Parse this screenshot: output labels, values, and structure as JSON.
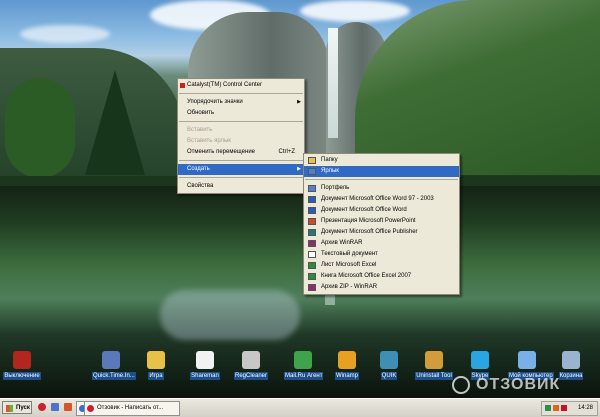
{
  "context_menu": {
    "items": [
      {
        "label": "Catalyst(TM) Control Center",
        "shortcut": "",
        "arrow": false,
        "disabled": false,
        "selected": false
      },
      {
        "separator": true
      },
      {
        "label": "Упорядочить значки",
        "shortcut": "",
        "arrow": true,
        "disabled": false,
        "selected": false
      },
      {
        "label": "Обновить",
        "shortcut": "",
        "arrow": false,
        "disabled": false,
        "selected": false
      },
      {
        "separator": true
      },
      {
        "label": "Вставить",
        "shortcut": "",
        "arrow": false,
        "disabled": true,
        "selected": false
      },
      {
        "label": "Вставить ярлык",
        "shortcut": "",
        "arrow": false,
        "disabled": true,
        "selected": false
      },
      {
        "label": "Отменить перемещение",
        "shortcut": "Ctrl+Z",
        "arrow": false,
        "disabled": false,
        "selected": false
      },
      {
        "separator": true
      },
      {
        "label": "Создать",
        "shortcut": "",
        "arrow": true,
        "disabled": false,
        "selected": true
      },
      {
        "separator": true
      },
      {
        "label": "Свойства",
        "shortcut": "",
        "arrow": false,
        "disabled": false,
        "selected": false
      }
    ]
  },
  "submenu": {
    "items": [
      {
        "label": "Папку",
        "icon": "folder-icon",
        "color": "#e8c14a",
        "selected": false
      },
      {
        "label": "Ярлык",
        "icon": "shortcut-icon",
        "color": "#4f7fd0",
        "selected": true
      },
      {
        "separator": true
      },
      {
        "label": "Портфель",
        "icon": "briefcase-icon",
        "color": "#5a7bd4",
        "selected": false
      },
      {
        "label": "Документ Microsoft Office Word 97 - 2003",
        "icon": "word-document-icon",
        "color": "#2b5bbd",
        "selected": false
      },
      {
        "label": "Документ Microsoft Office Word",
        "icon": "word-document-icon",
        "color": "#2b5bbd",
        "selected": false
      },
      {
        "label": "Презентация Microsoft PowerPoint",
        "icon": "powerpoint-icon",
        "color": "#d24726",
        "selected": false
      },
      {
        "label": "Документ Microsoft Office Publisher",
        "icon": "publisher-icon",
        "color": "#1f7a7a",
        "selected": false
      },
      {
        "label": "Архив WinRAR",
        "icon": "winrar-archive-icon",
        "color": "#8b2d6f",
        "selected": false
      },
      {
        "label": "Текстовый документ",
        "icon": "text-document-icon",
        "color": "#ffffff",
        "selected": false
      },
      {
        "label": "Лист Microsoft Excel",
        "icon": "excel-icon",
        "color": "#2e8b3e",
        "selected": false
      },
      {
        "label": "Книга Microsoft Office Excel 2007",
        "icon": "excel-icon",
        "color": "#2e8b3e",
        "selected": false
      },
      {
        "label": "Архив ZIP - WinRAR",
        "icon": "zip-archive-icon",
        "color": "#8b2d6f",
        "selected": false
      }
    ]
  },
  "desktop_icons": [
    {
      "label": "Выключение",
      "icon": "power-icon",
      "color": "#b3261e"
    },
    {
      "label": "Quick.Time.In...",
      "icon": "box-icon",
      "color": "#5b79b8"
    },
    {
      "label": "Игра",
      "icon": "folder-icon",
      "color": "#e8c14a"
    },
    {
      "label": "Shareman",
      "icon": "panda-icon",
      "color": "#f2f2f2"
    },
    {
      "label": "RegCleaner",
      "icon": "cleaner-icon",
      "color": "#c7c7c7"
    },
    {
      "label": "Mail.Ru Агент",
      "icon": "at-sign-icon",
      "color": "#3ea34a"
    },
    {
      "label": "Winamp",
      "icon": "winamp-icon",
      "color": "#e7a021"
    },
    {
      "label": "QUIK",
      "icon": "quik-icon",
      "color": "#3f8fb5"
    },
    {
      "label": "Uninstall Tool",
      "icon": "uninstall-icon",
      "color": "#d39c3a"
    },
    {
      "label": "Skype",
      "icon": "skype-icon",
      "color": "#2aa5e2"
    },
    {
      "label": "Мой компьютер",
      "icon": "computer-icon",
      "color": "#7ab0e8"
    },
    {
      "label": "Корзина",
      "icon": "recycle-bin-icon",
      "color": "#9ab4cf"
    }
  ],
  "taskbar": {
    "start_label": "Пуск",
    "quick_launch": [
      {
        "icon": "opera-icon",
        "color": "#cc1f2f"
      },
      {
        "icon": "show-desktop-icon",
        "color": "#4d74c9"
      },
      {
        "icon": "media-icon",
        "color": "#d8552a"
      }
    ],
    "tasks": [
      {
        "label": "",
        "icon": "explorer-icon",
        "color": "#3d6bd1"
      },
      {
        "label": "Отзовик - Написать от...",
        "icon": "opera-icon",
        "color": "#cc1f2f"
      }
    ],
    "clock": "14:28",
    "tray_icons": [
      {
        "icon": "network-icon",
        "color": "#2d8f4e"
      },
      {
        "icon": "volume-icon",
        "color": "#e2641e"
      },
      {
        "icon": "antivirus-icon",
        "color": "#c8102e"
      }
    ]
  },
  "watermark": "ОТЗОВИК"
}
